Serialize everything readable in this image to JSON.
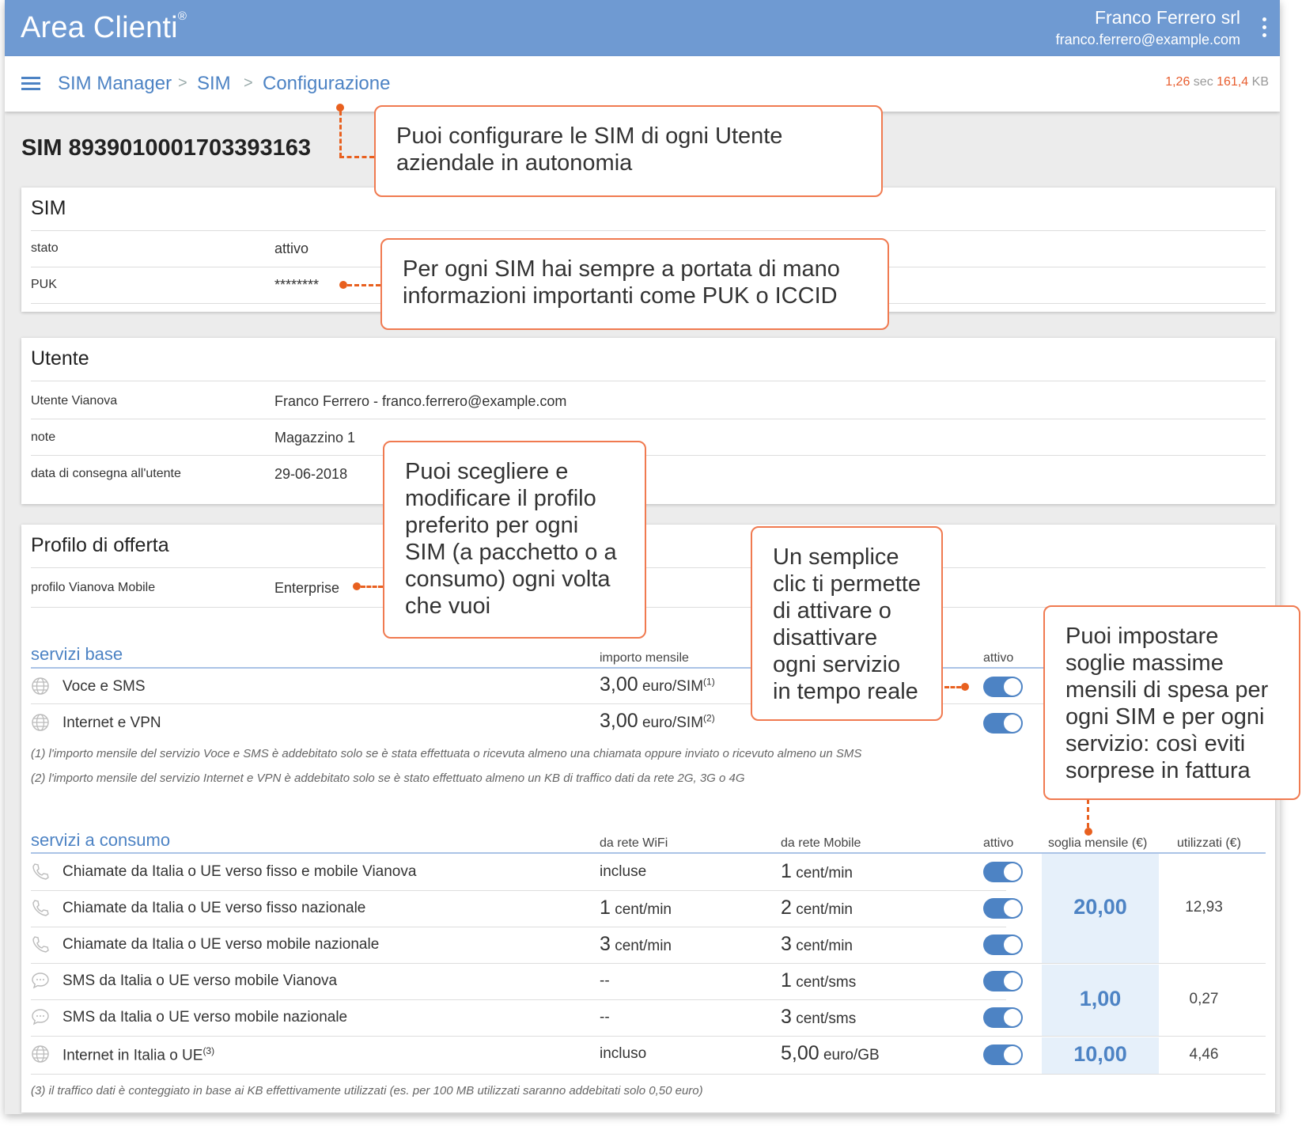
{
  "header": {
    "title": "Area Clienti",
    "reg": "®",
    "user_name": "Franco Ferrero srl",
    "user_email": "franco.ferrero@example.com"
  },
  "breadcrumb": {
    "items": [
      "SIM Manager",
      "SIM",
      "Configurazione"
    ]
  },
  "perf": {
    "time": "1,26",
    "time_unit": "sec",
    "size": "161,4",
    "size_unit": "KB"
  },
  "sim_title": "SIM 8939010001703393163",
  "sim_card": {
    "title": "SIM",
    "rows": [
      {
        "label": "stato",
        "value": "attivo"
      },
      {
        "label": "PUK",
        "value": "********"
      }
    ]
  },
  "user_card": {
    "title": "Utente",
    "rows": [
      {
        "label": "Utente Vianova",
        "value": "Franco Ferrero - franco.ferrero@example.com"
      },
      {
        "label": "note",
        "value": "Magazzino 1"
      },
      {
        "label": "data di consegna all'utente",
        "value": "29-06-2018"
      }
    ]
  },
  "profile_card": {
    "title": "Profilo di offerta",
    "profile_label": "profilo Vianova Mobile",
    "profile_value": "Enterprise"
  },
  "base_services": {
    "title": "servizi base",
    "col_amount": "importo mensile",
    "col_active": "attivo",
    "items": [
      {
        "name": "Voce e SMS",
        "amount": "3,00",
        "unit": "euro/SIM",
        "note": "(1)",
        "active": true
      },
      {
        "name": "Internet e VPN",
        "amount": "3,00",
        "unit": "euro/SIM",
        "note": "(2)",
        "active": true
      }
    ],
    "footnotes": [
      "(1) l'importo mensile del servizio Voce e SMS è addebitato solo se è stata effettuata o ricevuta almeno una chiamata oppure inviato o ricevuto almeno un SMS",
      "(2) l'importo mensile del servizio Internet e VPN è addebitato solo se è stato effettuato almeno un KB di traffico dati da rete 2G, 3G o 4G"
    ]
  },
  "usage_services": {
    "title": "servizi a consumo",
    "col_wifi": "da rete WiFi",
    "col_mobile": "da rete Mobile",
    "col_active": "attivo",
    "col_threshold": "soglia mensile (€)",
    "col_used": "utilizzati (€)",
    "items": [
      {
        "icon": "phone-icon",
        "name": "Chiamate da Italia o UE verso fisso e mobile Vianova",
        "wifi": "incluse",
        "mobile_num": "1",
        "mobile_unit": "cent/min",
        "active": true
      },
      {
        "icon": "phone-icon",
        "name": "Chiamate da Italia o UE verso fisso nazionale",
        "wifi_num": "1",
        "wifi_unit": "cent/min",
        "mobile_num": "2",
        "mobile_unit": "cent/min",
        "active": true
      },
      {
        "icon": "phone-icon",
        "name": "Chiamate da Italia o UE verso mobile nazionale",
        "wifi_num": "3",
        "wifi_unit": "cent/min",
        "mobile_num": "3",
        "mobile_unit": "cent/min",
        "active": true
      },
      {
        "icon": "sms-icon",
        "name": "SMS da Italia o UE verso mobile Vianova",
        "wifi": "--",
        "mobile_num": "1",
        "mobile_unit": "cent/sms",
        "active": true
      },
      {
        "icon": "sms-icon",
        "name": "SMS da Italia o UE verso mobile nazionale",
        "wifi": "--",
        "mobile_num": "3",
        "mobile_unit": "cent/sms",
        "active": true
      },
      {
        "icon": "globe-icon",
        "name": "Internet in Italia o UE",
        "note": "(3)",
        "wifi": "incluso",
        "mobile_num": "5,00",
        "mobile_unit": "euro/GB",
        "active": true
      }
    ],
    "groups": [
      {
        "threshold": "20,00",
        "used": "12,93"
      },
      {
        "threshold": "1,00",
        "used": "0,27"
      },
      {
        "threshold": "10,00",
        "used": "4,46"
      }
    ],
    "footnote": "(3) il traffico dati è conteggiato in base ai KB effettivamente utilizzati (es. per 100 MB utilizzati saranno addebitati solo 0,50 euro)"
  },
  "callouts": {
    "config": "Puoi configurare le SIM di ogni Utente aziendale in autonomia",
    "puk": "Per ogni SIM hai sempre a portata di mano informazioni importanti come PUK o ICCID",
    "profile": "Puoi scegliere e modificare il profilo preferito per ogni SIM (a pacchetto o a consumo) ogni volta che vuoi",
    "toggle": "Un semplice clic ti permette di attivare o disattivare ogni servizio in tempo reale",
    "threshold": "Puoi impostare soglie massime mensili di spesa per ogni SIM e per ogni servizio: così eviti sorprese in fattura"
  },
  "colors": {
    "header_bg": "#6f9ad2",
    "accent": "#4d83c4",
    "callout_border": "#f07a50",
    "perf_value": "#e85d2e"
  }
}
